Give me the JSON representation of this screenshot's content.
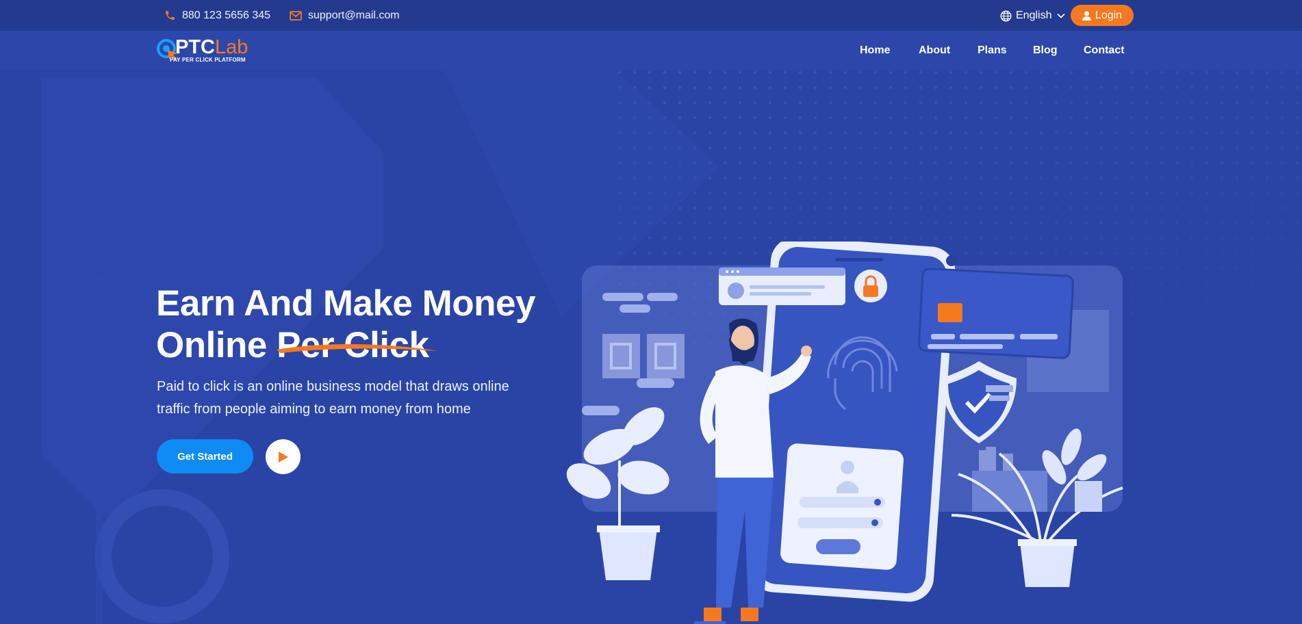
{
  "topbar": {
    "phone": "880 123 5656 345",
    "email": "support@mail.com",
    "language": "English",
    "login_label": "Login"
  },
  "brand": {
    "name_primary": "PTC",
    "name_secondary": "Lab",
    "tagline": "PAY PER CLICK PLATFORM"
  },
  "nav": {
    "items": [
      "Home",
      "About",
      "Plans",
      "Blog",
      "Contact"
    ]
  },
  "hero": {
    "headline_line1": "Earn And Make Money",
    "headline_line2": "Online Per Click",
    "subtext": "Paid to click is an online business model that draws online traffic from people aiming to earn money from home",
    "cta_label": "Get Started"
  },
  "icons": {
    "phone": "phone-icon",
    "email": "mail-icon",
    "language": "globe-icon",
    "login": "user-icon",
    "play": "play-icon"
  },
  "colors": {
    "background": "#2a44a6",
    "topbar": "#243a8f",
    "accent_orange": "#f7791e",
    "cta_blue": "#0f8bf5"
  }
}
